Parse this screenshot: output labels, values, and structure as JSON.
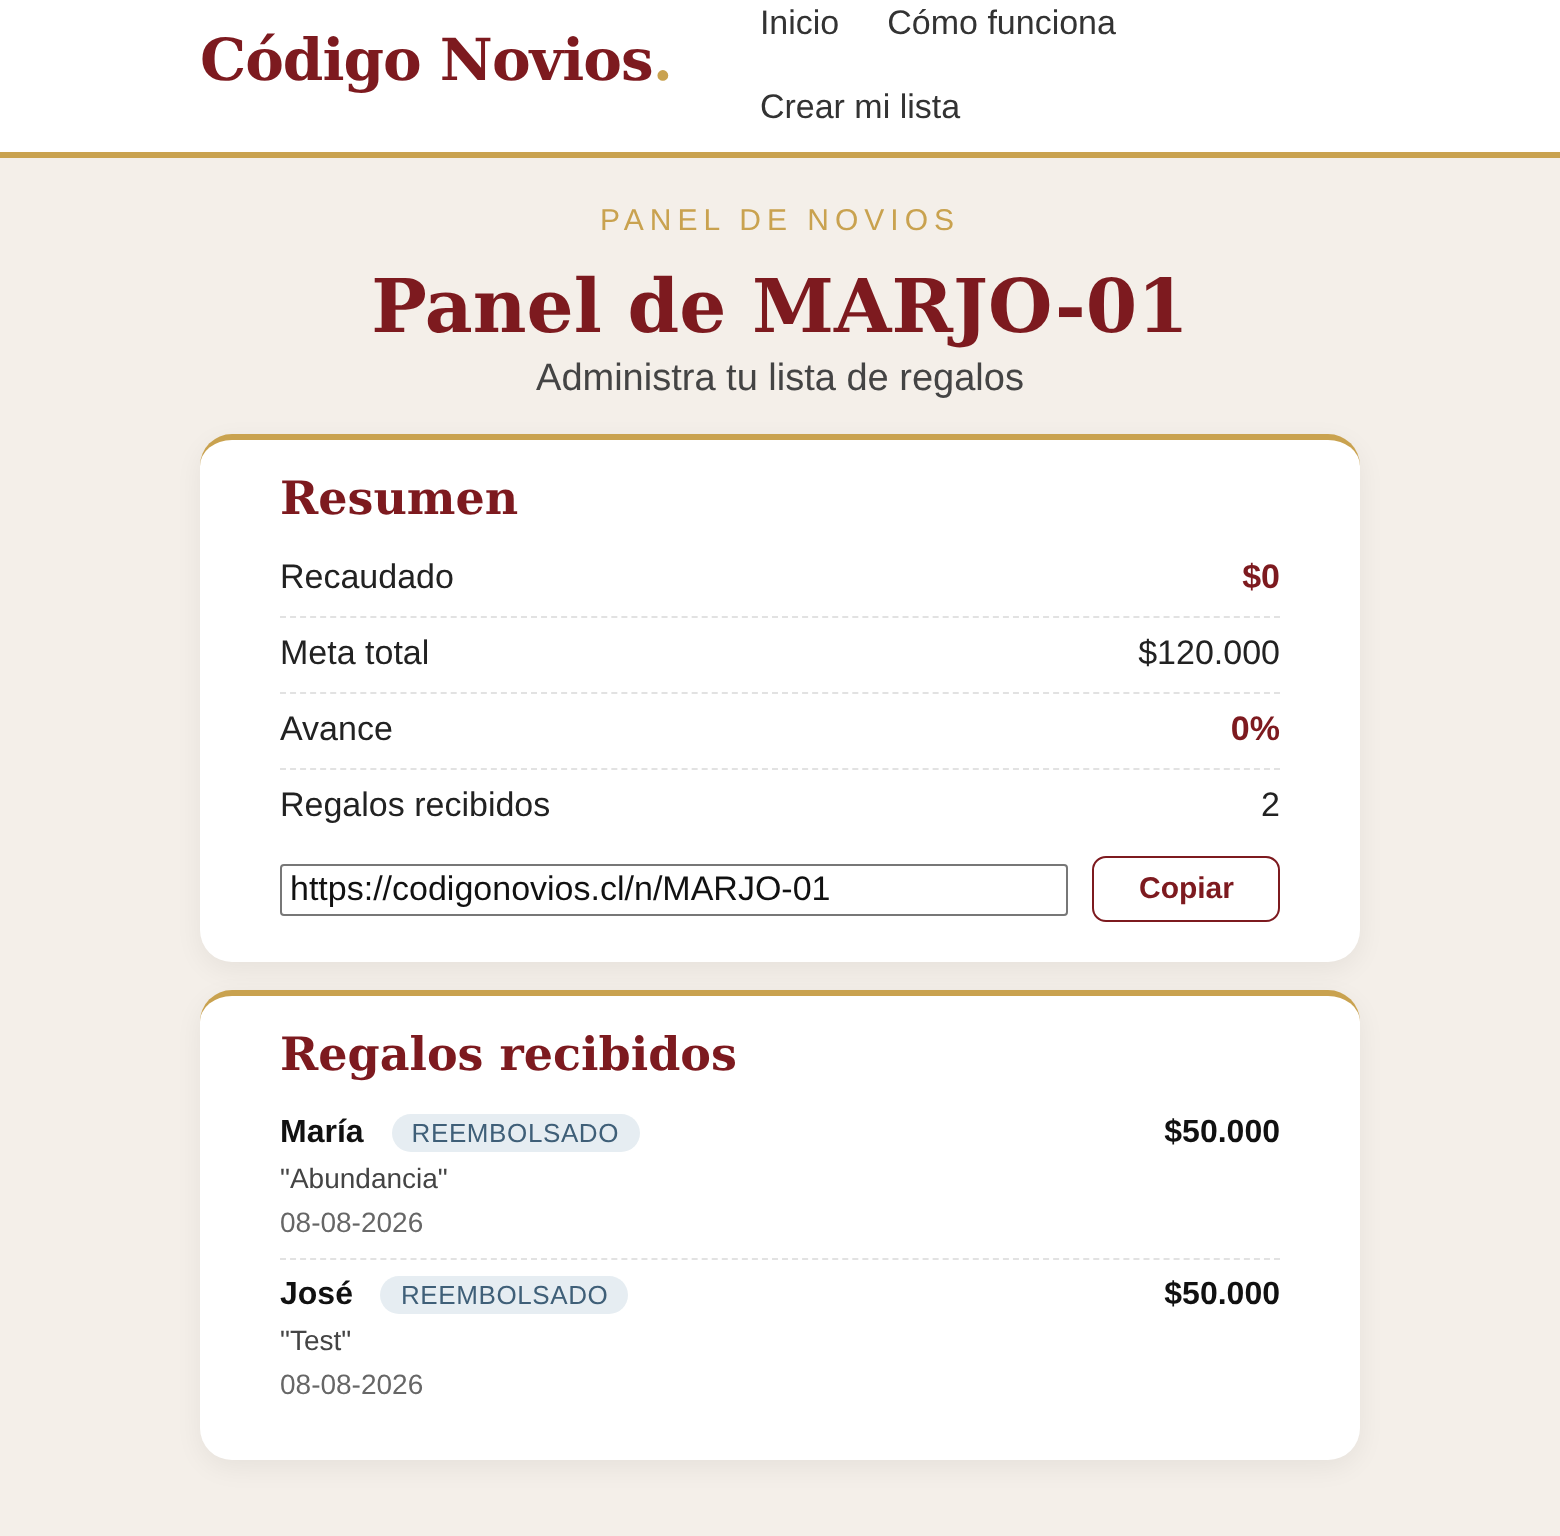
{
  "header": {
    "logo": {
      "name": "Código Novios",
      "mark": "."
    },
    "nav": [
      {
        "label": "Inicio"
      },
      {
        "label": "Cómo funciona"
      },
      {
        "label": "Crear mi lista"
      }
    ]
  },
  "hero": {
    "eyebrow": "PANEL DE NOVIOS",
    "title": "Panel de MARJO-01",
    "subtitle": "Administra tu lista de regalos"
  },
  "summary": {
    "title": "Resumen",
    "rows": [
      {
        "label": "Recaudado",
        "value": "$0",
        "highlight": true
      },
      {
        "label": "Meta total",
        "value": "$120.000",
        "highlight": false
      },
      {
        "label": "Avance",
        "value": "0%",
        "highlight": true
      },
      {
        "label": "Regalos recibidos",
        "value": "2",
        "highlight": false
      }
    ],
    "link": {
      "value": "https://codigonovios.cl/n/MARJO-01"
    },
    "copy_button": "Copiar"
  },
  "gifts": {
    "title": "Regalos recibidos",
    "items": [
      {
        "name": "María",
        "status": "REEMBOLSADO",
        "amount": "$50.000",
        "message": "\"Abundancia\"",
        "date": "08-08-2026"
      },
      {
        "name": "José",
        "status": "REEMBOLSADO",
        "amount": "$50.000",
        "message": "\"Test\"",
        "date": "08-08-2026"
      }
    ]
  }
}
